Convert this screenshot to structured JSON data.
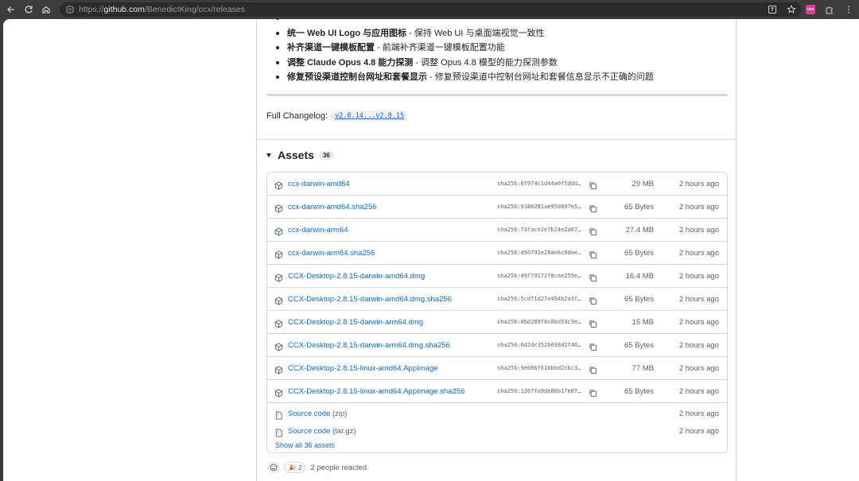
{
  "browser": {
    "url_prefix": "https://",
    "url_host": "github.com",
    "url_path": "/BenedictKing/ccx/releases",
    "extension_badge": "ccx"
  },
  "notes": [
    {
      "bold": "统一 Web UI Logo 与应用图标",
      "text": " - 保持 Web UI 与桌面端视觉一致性"
    },
    {
      "bold": "补齐渠道一键模板配置",
      "text": " - 前端补齐渠道一键模板配置功能"
    },
    {
      "bold": "调整 Claude Opus 4.8 能力探测",
      "text": " - 调整 Opus 4.8 模型的能力探测参数"
    },
    {
      "bold": "修复预设渠道控制台网址和套餐显示",
      "text": " - 修复预设渠道中控制台网址和套餐信息显示不正确的问题"
    }
  ],
  "changelog": {
    "label": "Full Changelog:",
    "link": "v2.8.14...v2.8.15"
  },
  "assets": {
    "title": "Assets",
    "count": "36",
    "items": [
      {
        "name": "ccx-darwin-amd64",
        "sha": "sha256:6f974c1d44a0f5ddd…",
        "size": "29 MB",
        "time": "2 hours ago"
      },
      {
        "name": "ccx-darwin-amd64.sha256",
        "sha": "sha256:9186281ae95d897e5…",
        "size": "65 Bytes",
        "time": "2 hours ago"
      },
      {
        "name": "ccx-darwin-arm64",
        "sha": "sha256:73face2e7b24e2a67…",
        "size": "27.4 MB",
        "time": "2 hours ago"
      },
      {
        "name": "ccx-darwin-arm64.sha256",
        "sha": "sha256:d50792e28ae6c9dee…",
        "size": "65 Bytes",
        "time": "2 hours ago"
      },
      {
        "name": "CCX-Desktop-2.8.15-darwin-amd64.dmg",
        "sha": "sha256:49f79172f8cae255e…",
        "size": "16.4 MB",
        "time": "2 hours ago"
      },
      {
        "name": "CCX-Desktop-2.8.15-darwin-amd64.dmg.sha256",
        "sha": "sha256:5cd71d27e494b2a3f…",
        "size": "65 Bytes",
        "time": "2 hours ago"
      },
      {
        "name": "CCX-Desktop-2.8.15-darwin-arm64.dmg",
        "sha": "sha256:6bd289f8c0bd53c3e…",
        "size": "15 MB",
        "time": "2 hours ago"
      },
      {
        "name": "CCX-Desktop-2.8.15-darwin-arm64.dmg.sha256",
        "sha": "sha256:6d2dc352b038d2f46…",
        "size": "65 Bytes",
        "time": "2 hours ago"
      },
      {
        "name": "CCX-Desktop-2.8.15-linux-amd64.AppImage",
        "sha": "sha256:9e08bf61bbbd2cbc3…",
        "size": "77 MB",
        "time": "2 hours ago"
      },
      {
        "name": "CCX-Desktop-2.8.15-linux-amd64.AppImage.sha256",
        "sha": "sha256:1267fa9de86b17e87…",
        "size": "65 Bytes",
        "time": "2 hours ago"
      }
    ],
    "sources": [
      {
        "name": "Source code",
        "ext": "(zip)",
        "time": "2 hours ago"
      },
      {
        "name": "Source code",
        "ext": "(tar.gz)",
        "time": "2 hours ago"
      }
    ],
    "show_all": "Show all 36 assets"
  },
  "reactions": {
    "count": "2",
    "text": "2 people reacted"
  }
}
